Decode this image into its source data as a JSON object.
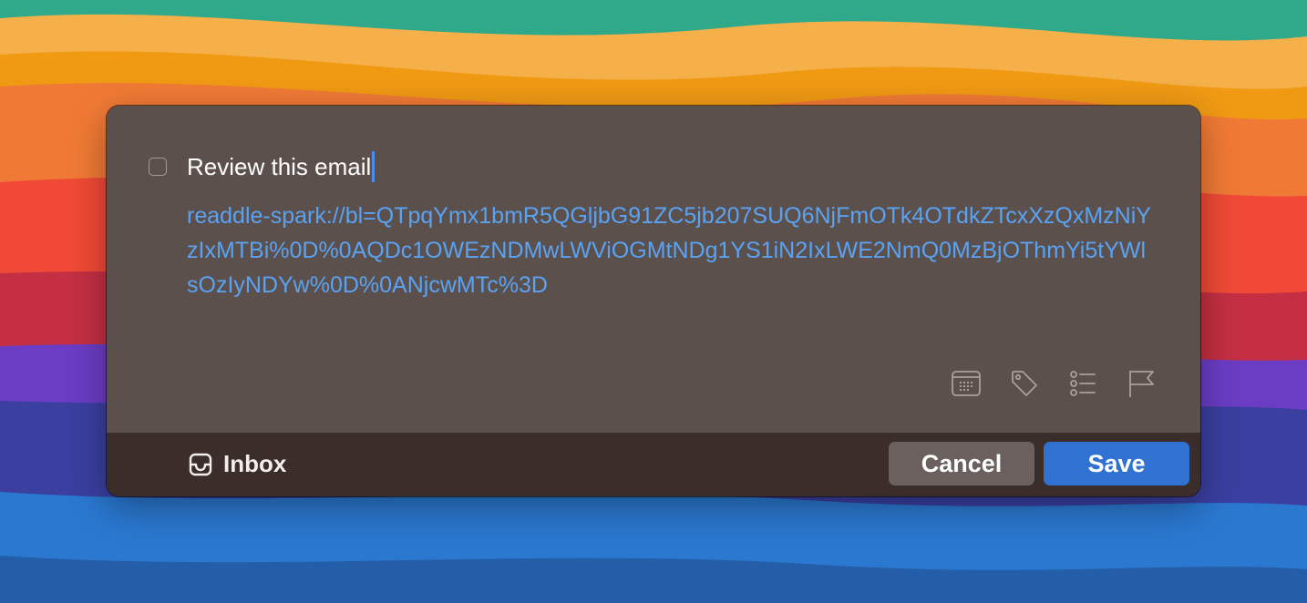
{
  "task": {
    "title": "Review this email",
    "completed": false,
    "notes_link": "readdle-spark://bl=QTpqYmx1bmR5QGljbG91ZC5jb207SUQ6NjFmOTk4OTdkZTcxXzQxMzNiYzIxMTBi%0D%0AQDc1OWEzNDMwLWViOGMtNDg1YS1iN2IxLWE2NmQ0MzBjOThmYi5tYWlsOzIyNDYw%0D%0ANjcwMTc%3D"
  },
  "toolbar": {
    "icons": [
      "calendar-icon",
      "tag-icon",
      "checklist-icon",
      "flag-icon"
    ]
  },
  "footer": {
    "list_name": "Inbox",
    "list_icon": "inbox-tray-icon",
    "cancel_label": "Cancel",
    "save_label": "Save"
  },
  "colors": {
    "panel": "#5c504d",
    "footer": "#3b2d29",
    "link": "#5aa2f2",
    "caret": "#4a8eea",
    "cancel_button": "#6b605d",
    "save_button": "#2f72d1"
  }
}
